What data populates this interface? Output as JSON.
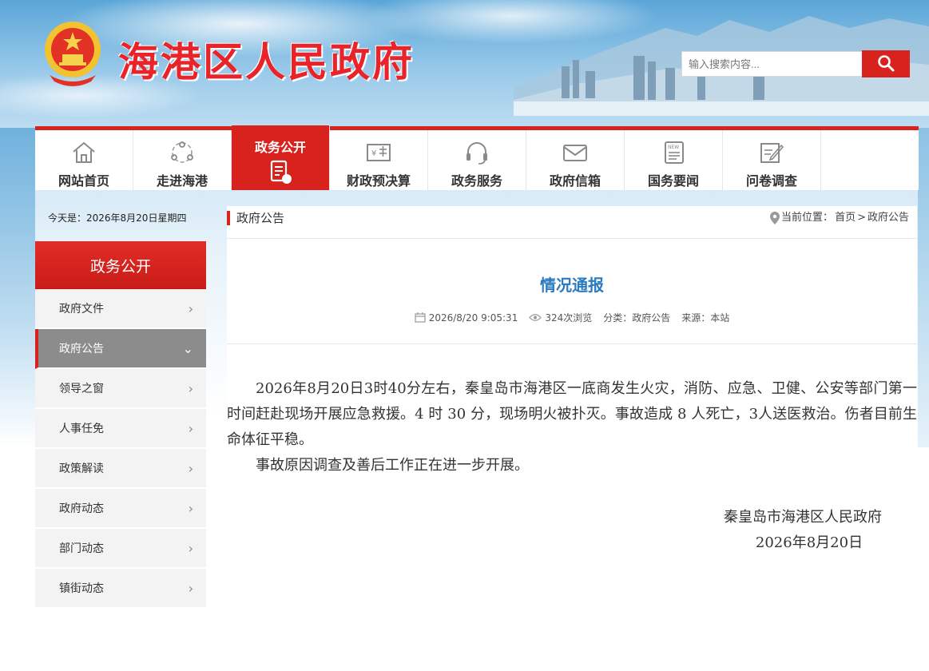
{
  "header": {
    "site_title": "海港区人民政府",
    "search_placeholder": "输入搜索内容..."
  },
  "nav": {
    "items": [
      {
        "label": "网站首页",
        "icon": "home-icon"
      },
      {
        "label": "走进海港",
        "icon": "people-icon"
      },
      {
        "label": "政务公开",
        "icon": "document-icon",
        "active": true
      },
      {
        "label": "财政预决算",
        "icon": "finance-icon"
      },
      {
        "label": "政务服务",
        "icon": "headset-icon"
      },
      {
        "label": "政府信箱",
        "icon": "mail-icon"
      },
      {
        "label": "国务要闻",
        "icon": "news-icon"
      },
      {
        "label": "问卷调查",
        "icon": "survey-icon"
      }
    ]
  },
  "sidebar": {
    "today": "今天是：2026年8月20日星期四",
    "heading": "政务公开",
    "items": [
      {
        "label": "政府文件"
      },
      {
        "label": "政府公告",
        "active": true
      },
      {
        "label": "领导之窗"
      },
      {
        "label": "人事任免"
      },
      {
        "label": "政策解读"
      },
      {
        "label": "政府动态"
      },
      {
        "label": "部门动态"
      },
      {
        "label": "镇街动态"
      }
    ]
  },
  "breadcrumb": {
    "section": "政府公告",
    "location_label": "当前位置：",
    "home": "首页",
    "separator": ">",
    "current": "政府公告"
  },
  "article": {
    "title": "情况通报",
    "datetime": "2026/8/20 9:05:31",
    "views": "324次浏览",
    "category": "分类：政府公告",
    "source": "来源：本站",
    "paragraphs": [
      "2026年8月20日3时40分左右，秦皇岛市海港区一底商发生火灾，消防、应急、卫健、公安等部门第一时间赶赴现场开展应急救援。4 时 30 分，现场明火被扑灭。事故造成 8 人死亡，3人送医救治。伤者目前生命体征平稳。",
      "事故原因调查及善后工作正在进一步开展。"
    ],
    "signature": "秦皇岛市海港区人民政府",
    "sign_date": "2026年8月20日"
  },
  "colors": {
    "brand_red": "#d8221e",
    "title_blue": "#2a7bc0"
  }
}
